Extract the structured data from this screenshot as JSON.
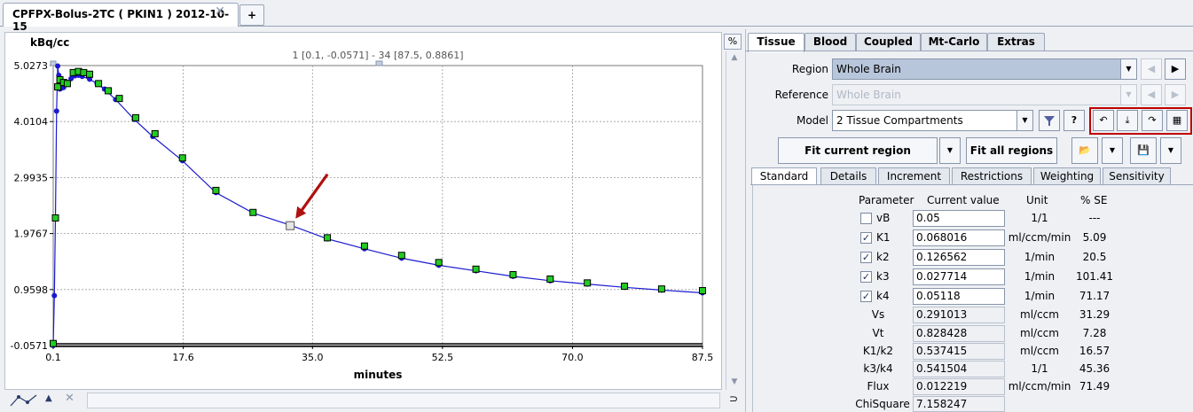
{
  "window": {
    "tab_title": "CPFPX-Bolus-2TC ( PKIN1 ) 2012-10-15",
    "add_tab_label": "+"
  },
  "chart": {
    "percent_button": "%",
    "range_label": "1 [0.1, -0.0571] - 34 [87.5, 0.8861]"
  },
  "chart_data": {
    "type": "scatter",
    "ylabel": "kBq/cc",
    "xlabel": "minutes",
    "xlim": [
      0.1,
      87.5
    ],
    "ylim": [
      -0.0571,
      5.0273
    ],
    "x_ticks": [
      "0.1",
      "17.6",
      "35.0",
      "52.5",
      "70.0",
      "87.5"
    ],
    "y_ticks": [
      "5.0273",
      "4.0104",
      "2.9935",
      "1.9767",
      "0.9598",
      "-0.0571"
    ],
    "grid": true,
    "colors": {
      "fit": "#1a1ad0",
      "measured": "#22cc22",
      "marker": "#000000"
    },
    "series": [
      {
        "x": [
          0.1,
          0.25,
          0.4,
          0.55,
          0.7,
          0.85,
          1.0,
          1.25,
          1.5,
          2.0,
          2.5,
          3.0,
          3.5,
          4.0,
          5.0,
          6.0,
          7.0,
          8.5,
          11.0,
          13.5,
          17.5,
          22.0,
          27.0,
          32.0,
          37.0,
          42.0,
          47.0,
          52.0,
          57.0,
          62.0,
          67.0,
          72.0,
          77.0,
          82.0,
          87.5
        ],
        "y": [
          -0.057,
          0.85,
          2.25,
          4.2,
          5.02,
          4.85,
          4.6,
          4.62,
          4.63,
          4.72,
          4.79,
          4.84,
          4.85,
          4.83,
          4.78,
          4.7,
          4.6,
          4.41,
          4.05,
          3.74,
          3.3,
          2.72,
          2.35,
          2.13,
          1.88,
          1.7,
          1.53,
          1.4,
          1.3,
          1.2,
          1.12,
          1.06,
          1.0,
          0.95,
          0.9
        ]
      },
      {
        "x": [
          0.1,
          0.4,
          0.7,
          1.0,
          1.5,
          2.0,
          2.8,
          3.5,
          4.2,
          5.0,
          6.2,
          7.5,
          9.0,
          11.2,
          13.8,
          17.5,
          22.0,
          27.0,
          37.0,
          42.0,
          47.0,
          52.0,
          57.0,
          62.0,
          67.0,
          72.0,
          77.0,
          82.0,
          87.5
        ],
        "y": [
          -0.02,
          2.26,
          4.64,
          4.77,
          4.72,
          4.7,
          4.9,
          4.92,
          4.9,
          4.87,
          4.7,
          4.57,
          4.43,
          4.08,
          3.79,
          3.35,
          2.76,
          2.36,
          1.9,
          1.75,
          1.58,
          1.45,
          1.33,
          1.23,
          1.15,
          1.08,
          1.02,
          0.97,
          0.94
        ]
      }
    ],
    "selected_point": {
      "x": 32.0,
      "y": 2.12
    }
  },
  "panel": {
    "main_tabs": [
      "Tissue",
      "Blood",
      "Coupled",
      "Mt-Carlo",
      "Extras"
    ],
    "region_label": "Region",
    "region_value": "Whole Brain",
    "reference_label": "Reference",
    "reference_value": "Whole Brain",
    "model_label": "Model",
    "model_value": "2 Tissue Compartments",
    "help_label": "?",
    "fit_current_label": "Fit current region",
    "fit_all_label": "Fit all regions",
    "sub_tabs": [
      "Standard",
      "Details",
      "Increment",
      "Restrictions",
      "Weighting",
      "Sensitivity"
    ]
  },
  "params": {
    "headers": {
      "parameter": "Parameter",
      "value": "Current value",
      "unit": "Unit",
      "se": "% SE"
    },
    "rows": [
      {
        "name": "vB",
        "value": "0.05",
        "unit": "1/1",
        "se": "---",
        "checked": ""
      },
      {
        "name": "K1",
        "value": "0.068016",
        "unit": "ml/ccm/min",
        "se": "5.09",
        "checked": "✓"
      },
      {
        "name": "k2",
        "value": "0.126562",
        "unit": "1/min",
        "se": "20.5",
        "checked": "✓"
      },
      {
        "name": "k3",
        "value": "0.027714",
        "unit": "1/min",
        "se": "101.41",
        "checked": "✓"
      },
      {
        "name": "k4",
        "value": "0.05118",
        "unit": "1/min",
        "se": "71.17",
        "checked": "✓"
      },
      {
        "name": "Vs",
        "value": "0.291013",
        "unit": "ml/ccm",
        "se": "31.29"
      },
      {
        "name": "Vt",
        "value": "0.828428",
        "unit": "ml/ccm",
        "se": "7.28"
      },
      {
        "name": "K1/k2",
        "value": "0.537415",
        "unit": "ml/ccm",
        "se": "16.57"
      },
      {
        "name": "k3/k4",
        "value": "0.541504",
        "unit": "1/1",
        "se": "45.36"
      },
      {
        "name": "Flux",
        "value": "0.012219",
        "unit": "ml/ccm/min",
        "se": "71.49"
      },
      {
        "name": "ChiSquare",
        "value": "7.158247",
        "unit": "",
        "se": ""
      }
    ]
  }
}
